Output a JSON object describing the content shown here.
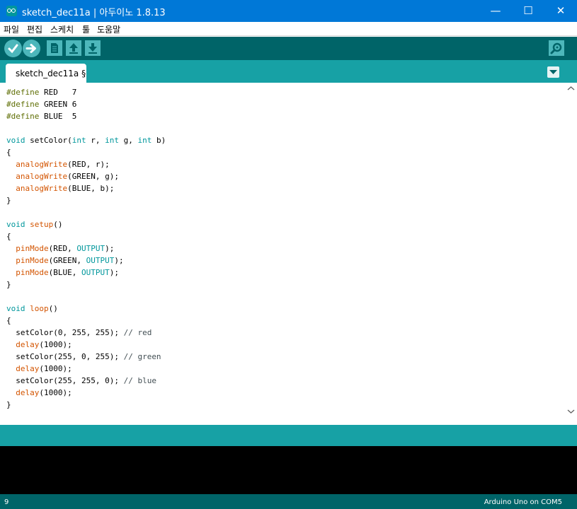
{
  "window": {
    "title": "sketch_dec11a | 아두이노 1.8.13",
    "controls": {
      "minimize": "—",
      "maximize": "☐",
      "close": "✕"
    }
  },
  "menu": {
    "items": [
      "파일",
      "편집",
      "스케치",
      "툴",
      "도움말"
    ]
  },
  "toolbar": {
    "buttons": [
      "verify",
      "upload",
      "new",
      "open",
      "save"
    ],
    "right_button": "serial-monitor"
  },
  "tabs": [
    {
      "label": "sketch_dec11a §",
      "active": true
    }
  ],
  "editor": {
    "lines": [
      [
        {
          "t": "#define",
          "c": "pp"
        },
        {
          "t": " RED   7"
        }
      ],
      [
        {
          "t": "#define",
          "c": "pp"
        },
        {
          "t": " GREEN 6"
        }
      ],
      [
        {
          "t": "#define",
          "c": "pp"
        },
        {
          "t": " BLUE  5"
        }
      ],
      [],
      [
        {
          "t": "void",
          "c": "kw"
        },
        {
          "t": " setColor("
        },
        {
          "t": "int",
          "c": "kw"
        },
        {
          "t": " r, "
        },
        {
          "t": "int",
          "c": "kw"
        },
        {
          "t": " g, "
        },
        {
          "t": "int",
          "c": "kw"
        },
        {
          "t": " b)"
        }
      ],
      [
        {
          "t": "{"
        }
      ],
      [
        {
          "t": "  "
        },
        {
          "t": "analogWrite",
          "c": "fn"
        },
        {
          "t": "(RED, r);"
        }
      ],
      [
        {
          "t": "  "
        },
        {
          "t": "analogWrite",
          "c": "fn"
        },
        {
          "t": "(GREEN, g);"
        }
      ],
      [
        {
          "t": "  "
        },
        {
          "t": "analogWrite",
          "c": "fn"
        },
        {
          "t": "(BLUE, b);"
        }
      ],
      [
        {
          "t": "}"
        }
      ],
      [],
      [
        {
          "t": "void",
          "c": "kw"
        },
        {
          "t": " "
        },
        {
          "t": "setup",
          "c": "fn"
        },
        {
          "t": "()"
        }
      ],
      [
        {
          "t": "{"
        }
      ],
      [
        {
          "t": "  "
        },
        {
          "t": "pinMode",
          "c": "fn"
        },
        {
          "t": "(RED, "
        },
        {
          "t": "OUTPUT",
          "c": "kw"
        },
        {
          "t": ");"
        }
      ],
      [
        {
          "t": "  "
        },
        {
          "t": "pinMode",
          "c": "fn"
        },
        {
          "t": "(GREEN, "
        },
        {
          "t": "OUTPUT",
          "c": "kw"
        },
        {
          "t": ");"
        }
      ],
      [
        {
          "t": "  "
        },
        {
          "t": "pinMode",
          "c": "fn"
        },
        {
          "t": "(BLUE, "
        },
        {
          "t": "OUTPUT",
          "c": "kw"
        },
        {
          "t": ");"
        }
      ],
      [
        {
          "t": "}"
        }
      ],
      [],
      [
        {
          "t": "void",
          "c": "kw"
        },
        {
          "t": " "
        },
        {
          "t": "loop",
          "c": "fn"
        },
        {
          "t": "()"
        }
      ],
      [
        {
          "t": "{"
        }
      ],
      [
        {
          "t": "  setColor(0, 255, 255); "
        },
        {
          "t": "// red",
          "c": "cm"
        }
      ],
      [
        {
          "t": "  "
        },
        {
          "t": "delay",
          "c": "fn"
        },
        {
          "t": "(1000);"
        }
      ],
      [
        {
          "t": "  setColor(255, 0, 255); "
        },
        {
          "t": "// green",
          "c": "cm"
        }
      ],
      [
        {
          "t": "  "
        },
        {
          "t": "delay",
          "c": "fn"
        },
        {
          "t": "(1000);"
        }
      ],
      [
        {
          "t": "  setColor(255, 255, 0); "
        },
        {
          "t": "// blue",
          "c": "cm"
        }
      ],
      [
        {
          "t": "  "
        },
        {
          "t": "delay",
          "c": "fn"
        },
        {
          "t": "(1000);"
        }
      ],
      [
        {
          "t": "}"
        }
      ]
    ]
  },
  "status": {
    "line_number": "9",
    "board": "Arduino Uno on COM5"
  },
  "colors": {
    "titlebar": "#0078d7",
    "toolbar": "#006468",
    "tabbar": "#17a1a5",
    "toolbar_button": "#4db7bb",
    "preprocessor": "#5e6d03",
    "keyword": "#00979c",
    "function": "#d35400",
    "comment": "#434f54"
  }
}
